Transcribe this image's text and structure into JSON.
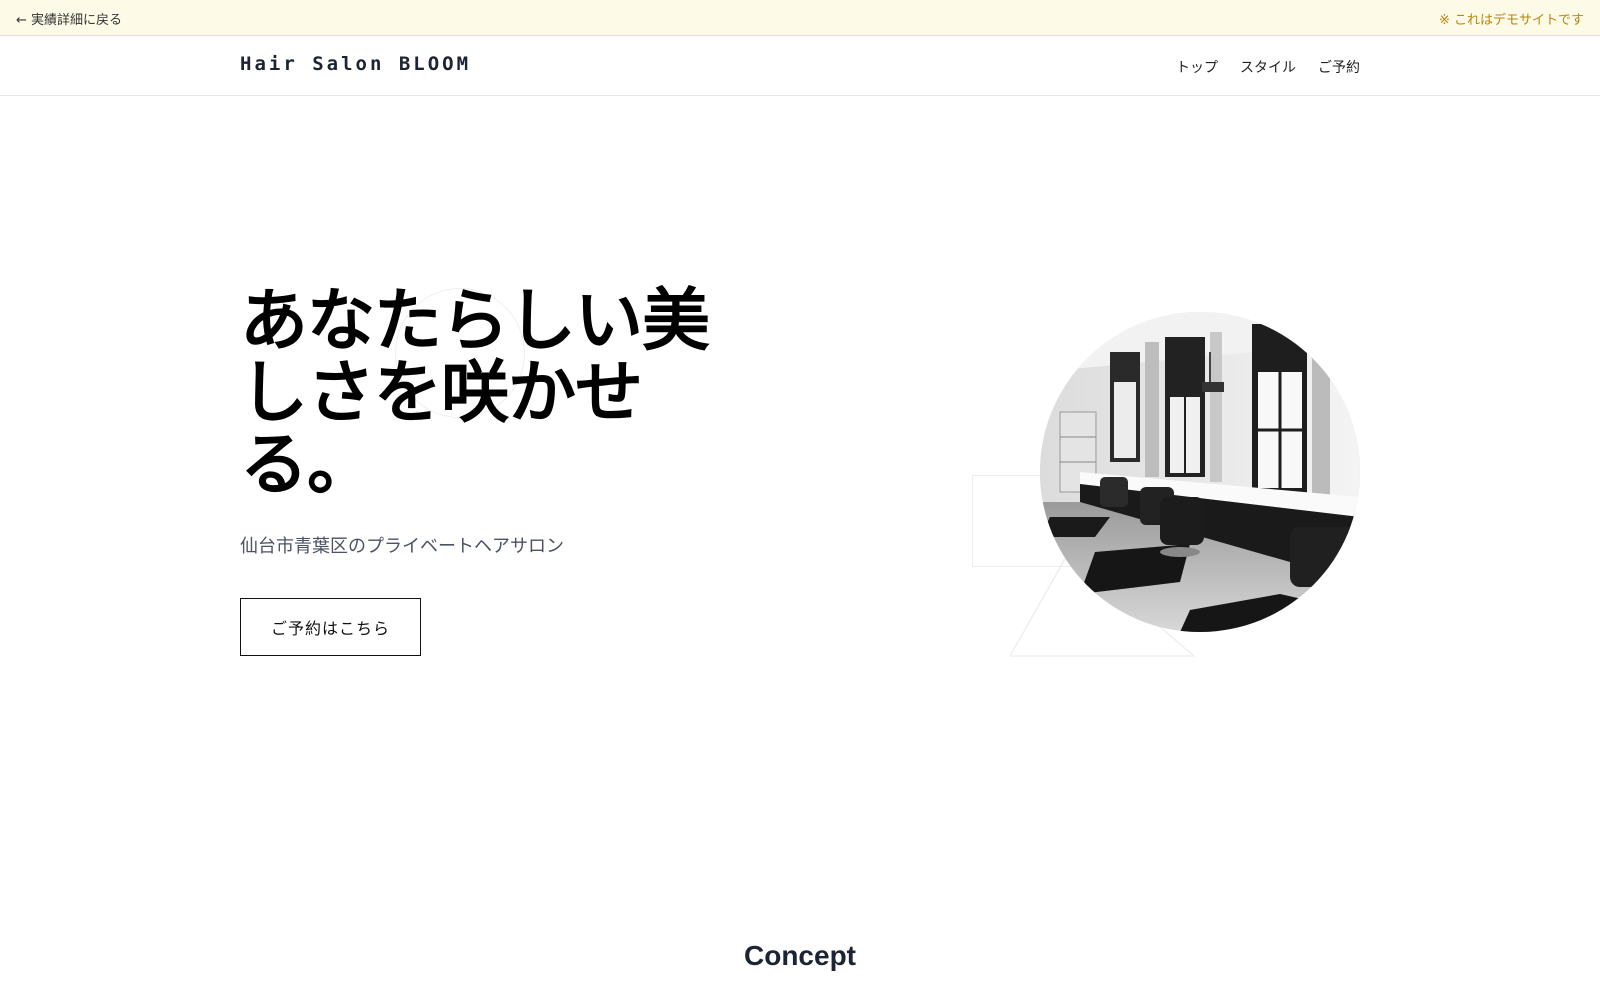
{
  "demo_bar": {
    "back_link": "← 実績詳細に戻る",
    "notice": "※ これはデモサイトです"
  },
  "header": {
    "site_title": "Hair Salon BLOOM",
    "nav": [
      "トップ",
      "スタイル",
      "ご予約"
    ]
  },
  "hero": {
    "title": "あなたらしい美しさを咲かせる。",
    "subtitle": "仙台市青葉区のプライベートヘアサロン",
    "cta": "ご予約はこちら"
  },
  "concept": {
    "title": "Concept"
  },
  "colors": {
    "demo_bar_bg": "#fdfbe8",
    "notice_text": "#b8860b",
    "heading": "#1c2434"
  },
  "icons": {
    "back": "left-arrow-icon"
  }
}
